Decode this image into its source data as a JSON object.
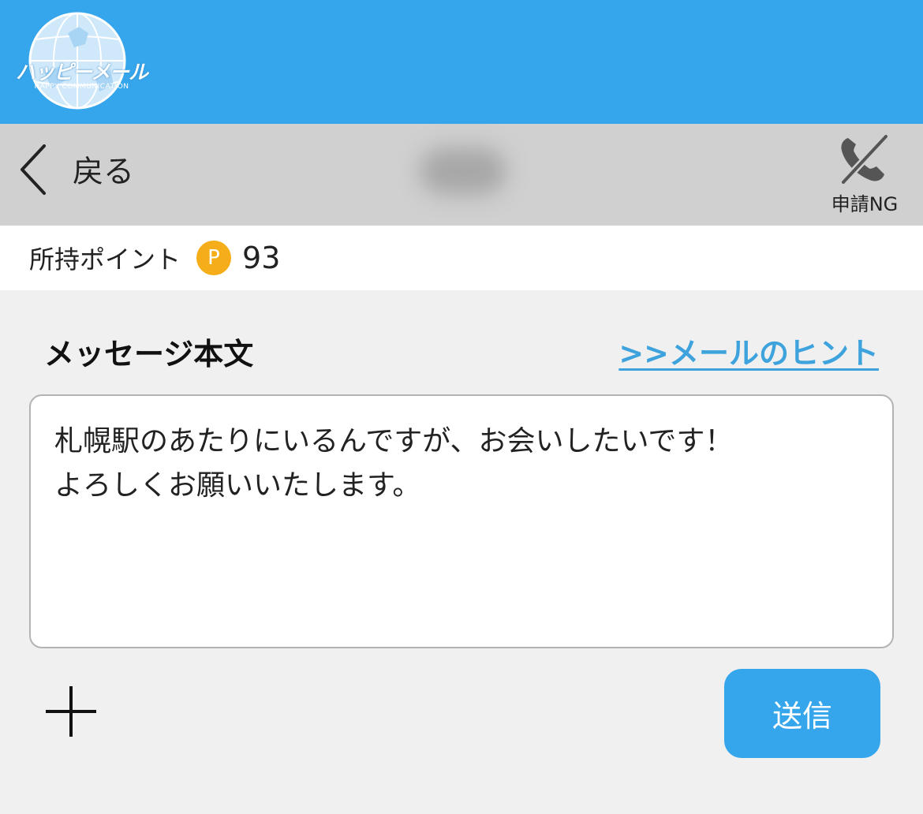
{
  "header": {
    "logo_text": "ハッピーメール",
    "logo_tagline": "HAPPY COMMUNICATION"
  },
  "navbar": {
    "back_label": "戻る",
    "partner_name": "",
    "call_status_label": "申請NG"
  },
  "points": {
    "label": "所持ポイント",
    "badge": "P",
    "value": "93"
  },
  "compose": {
    "title": "メッセージ本文",
    "hint_link": ">>メールのヒント",
    "message": "札幌駅のあたりにいるんですが、お会いしたいです！\nよろしくお願いいたします。"
  },
  "actions": {
    "send_label": "送信"
  },
  "colors": {
    "header_bg": "#36a6ec",
    "navbar_bg": "#d0d0d0",
    "point_badge": "#f5ae1a",
    "link": "#3ea3dd",
    "send_button": "#36a6ec"
  }
}
